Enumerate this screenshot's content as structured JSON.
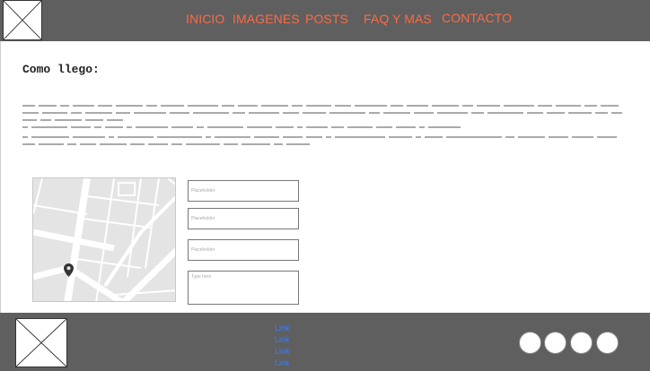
{
  "header": {
    "logo_icon": "image-placeholder-icon",
    "nav": [
      {
        "label": "INICIO"
      },
      {
        "label": "IMAGENES"
      },
      {
        "label": "POSTS"
      },
      {
        "label": "FAQ Y MAS"
      },
      {
        "label": "CONTACTO"
      }
    ],
    "nav_color": "#ff6a46",
    "background": "#5f5f5f"
  },
  "main": {
    "title": "Como llego:",
    "map_icon": "map-pin-icon",
    "form": {
      "field_1_placeholder": "Placeholder",
      "field_2_placeholder": "Placeholder",
      "field_3_placeholder": "Placeholder",
      "message_placeholder": "Type here"
    }
  },
  "footer": {
    "logo_icon": "image-placeholder-icon",
    "links": [
      {
        "label": "Link"
      },
      {
        "label": "Link"
      },
      {
        "label": "Link"
      },
      {
        "label": "Link"
      }
    ],
    "link_color": "#3b7cff",
    "social_icons": [
      "social-circle-icon",
      "social-circle-icon",
      "social-circle-icon",
      "social-circle-icon"
    ]
  }
}
